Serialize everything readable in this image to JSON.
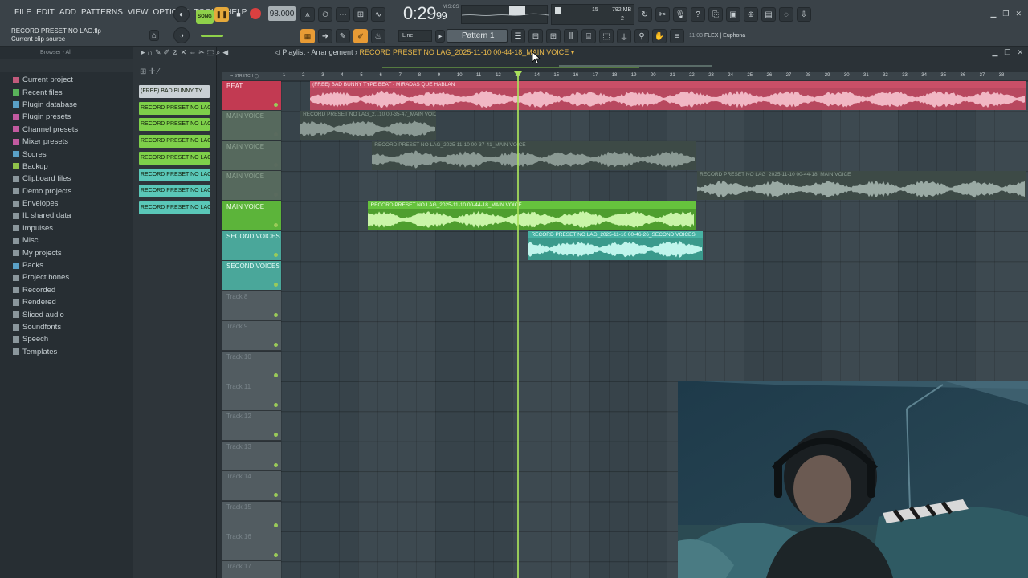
{
  "menu": [
    "FILE",
    "EDIT",
    "ADD",
    "PATTERNS",
    "VIEW",
    "OPTIONS",
    "TOOLS",
    "HELP"
  ],
  "project": {
    "file_name": "RECORD PRESET NO LAG.flp",
    "hint_line": "Current clip source"
  },
  "transport": {
    "song_label": "SONG",
    "tempo": "98.000",
    "time_main": "0:29",
    "time_sub": "99",
    "time_label": "M:S:CS"
  },
  "cpu": {
    "value1": "15",
    "memory": "792 MB",
    "value2": "2"
  },
  "toolbar2": {
    "snap_label": "Line",
    "pattern_label": "Pattern 1",
    "hint_prefix": "11:03",
    "hint_text": "FLEX | Euphona"
  },
  "browser": {
    "header": "Browser - All",
    "items": [
      {
        "label": "Current project",
        "color": "#c25a7c"
      },
      {
        "label": "Recent files",
        "color": "#59b35a"
      },
      {
        "label": "Plugin database",
        "color": "#5aa0c6"
      },
      {
        "label": "Plugin presets",
        "color": "#c25aa0"
      },
      {
        "label": "Channel presets",
        "color": "#c25aa0"
      },
      {
        "label": "Mixer presets",
        "color": "#c25aa0"
      },
      {
        "label": "Scores",
        "color": "#5aa0c6"
      },
      {
        "label": "Backup",
        "color": "#8fc14a"
      },
      {
        "label": "Clipboard files",
        "color": "#8a969c"
      },
      {
        "label": "Demo projects",
        "color": "#8a969c"
      },
      {
        "label": "Envelopes",
        "color": "#8a969c"
      },
      {
        "label": "IL shared data",
        "color": "#8a969c"
      },
      {
        "label": "Impulses",
        "color": "#8a969c"
      },
      {
        "label": "Misc",
        "color": "#8a969c"
      },
      {
        "label": "My projects",
        "color": "#8a969c"
      },
      {
        "label": "Packs",
        "color": "#5aa0c6"
      },
      {
        "label": "Project bones",
        "color": "#8a969c"
      },
      {
        "label": "Recorded",
        "color": "#8a969c"
      },
      {
        "label": "Rendered",
        "color": "#8a969c"
      },
      {
        "label": "Sliced audio",
        "color": "#8a969c"
      },
      {
        "label": "Soundfonts",
        "color": "#8a969c"
      },
      {
        "label": "Speech",
        "color": "#8a969c"
      },
      {
        "label": "Templates",
        "color": "#8a969c"
      }
    ]
  },
  "clip_list": [
    {
      "label": "(FREE) BAD BUNNY TY..",
      "color": "#c9d0d4"
    },
    {
      "label": "RECORD PRESET NO LAG_2..",
      "color": "#7ed04a"
    },
    {
      "label": "RECORD PRESET NO LAG_2..",
      "color": "#7ed04a"
    },
    {
      "label": "RECORD PRESET NO LAG_2..",
      "color": "#7ed04a"
    },
    {
      "label": "RECORD PRESET NO LAG_2..",
      "color": "#7ed04a"
    },
    {
      "label": "RECORD PRESET NO LAG_2..",
      "color": "#5ac7b8"
    },
    {
      "label": "RECORD PRESET NO LAG_2..",
      "color": "#5ac7b8"
    },
    {
      "label": "RECORD PRESET NO LAG_2..",
      "color": "#5ac7b8"
    }
  ],
  "playlist": {
    "title": "Playlist - Arrangement",
    "current_clip": "RECORD PRESET NO LAG_2025-11-10 00-44-18_MAIN VOICE",
    "ruler": [
      "1",
      "2",
      "3",
      "4",
      "5",
      "6",
      "7",
      "8",
      "9",
      "10",
      "11",
      "12",
      "13",
      "14",
      "15",
      "16",
      "17",
      "18",
      "19",
      "20",
      "21",
      "22",
      "23",
      "24",
      "25",
      "26",
      "27",
      "28",
      "29",
      "30",
      "31",
      "32",
      "33",
      "34",
      "35",
      "36",
      "37",
      "38"
    ],
    "tracks": [
      {
        "label": "BEAT",
        "color": "#c23a52",
        "text": "#ffe6ea",
        "muted": false
      },
      {
        "label": "MAIN VOICE",
        "color": "#56695d",
        "text": "#8ea392",
        "muted": true
      },
      {
        "label": "MAIN VOICE",
        "color": "#56695d",
        "text": "#8ea392",
        "muted": true
      },
      {
        "label": "MAIN VOICE",
        "color": "#56695d",
        "text": "#8ea392",
        "muted": true
      },
      {
        "label": "MAIN VOICE",
        "color": "#5cb43a",
        "text": "#f0ffe6",
        "muted": false
      },
      {
        "label": "SECOND VOICES",
        "color": "#4aa79a",
        "text": "#eafffb",
        "muted": false
      },
      {
        "label": "SECOND VOICES",
        "color": "#4aa79a",
        "text": "#eafffb",
        "muted": false
      },
      {
        "label": "Track 8",
        "color": "#525c61",
        "text": "#79848a",
        "muted": false
      },
      {
        "label": "Track 9",
        "color": "#525c61",
        "text": "#79848a",
        "muted": false
      },
      {
        "label": "Track 10",
        "color": "#525c61",
        "text": "#79848a",
        "muted": false
      },
      {
        "label": "Track 11",
        "color": "#525c61",
        "text": "#79848a",
        "muted": false
      },
      {
        "label": "Track 12",
        "color": "#525c61",
        "text": "#79848a",
        "muted": false
      },
      {
        "label": "Track 13",
        "color": "#525c61",
        "text": "#79848a",
        "muted": false
      },
      {
        "label": "Track 14",
        "color": "#525c61",
        "text": "#79848a",
        "muted": false
      },
      {
        "label": "Track 15",
        "color": "#525c61",
        "text": "#79848a",
        "muted": false
      },
      {
        "label": "Track 16",
        "color": "#525c61",
        "text": "#79848a",
        "muted": false
      },
      {
        "label": "Track 17",
        "color": "#525c61",
        "text": "#79848a",
        "muted": false
      }
    ],
    "clips": [
      {
        "label": "(FREE) BAD BUNNY TYPE BEAT - MIRADAS QUE HABLAN",
        "track": 0,
        "start_bar": 2.5,
        "end_bar": 39.5,
        "color": "#b8485f",
        "wave": "#f1b7c4",
        "header": "#c94f67",
        "text": "#ffe7ed"
      },
      {
        "label": "RECORD PRESET NO LAG_2...10 00-35-47_MAIN VOICE",
        "track": 1,
        "start_bar": 2.0,
        "end_bar": 9.0,
        "color": "#3d4a46",
        "wave": "#8b9a94",
        "header": "#3d4a46",
        "text": "#8ea096"
      },
      {
        "label": "RECORD PRESET NO LAG_2025-11-10 00-37-41_MAIN VOICE",
        "track": 2,
        "start_bar": 5.7,
        "end_bar": 22.4,
        "color": "#3d4a46",
        "wave": "#8b9a94",
        "header": "#3d4a46",
        "text": "#8ea096"
      },
      {
        "label": "RECORD PRESET NO LAG_2025-11-10 00-44-18_MAIN VOICE",
        "track": 3,
        "start_bar": 22.5,
        "end_bar": 39.5,
        "color": "#3d4a46",
        "wave": "#9aaaa4",
        "header": "#3d4a46",
        "text": "#8ea096"
      },
      {
        "label": "RECORD PRESET NO LAG_2025-11-10 00-44-18_MAIN VOICE",
        "track": 4,
        "start_bar": 5.5,
        "end_bar": 22.4,
        "color": "#4e9e2e",
        "wave": "#c9f5a8",
        "header": "#66c33d",
        "text": "#f2ffe8"
      },
      {
        "label": "RECORD PRESET NO LAG_2025-11-10 00-46-26_SECOND VOICES",
        "track": 5,
        "start_bar": 13.8,
        "end_bar": 22.8,
        "color": "#3a9a8c",
        "wave": "#bff5ec",
        "header": "#47b2a3",
        "text": "#eafffb"
      }
    ]
  }
}
